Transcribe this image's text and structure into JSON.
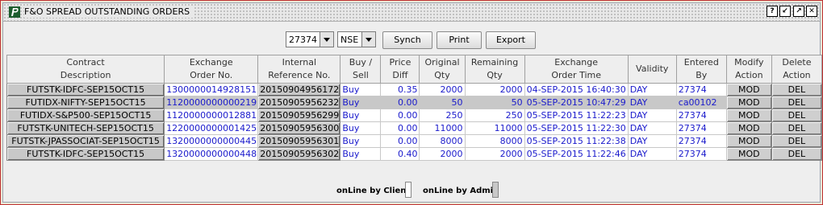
{
  "window": {
    "title": "F&O SPREAD OUTSTANDING ORDERS",
    "controls": [
      "?",
      "minimize",
      "maximize",
      "close"
    ]
  },
  "toolbar": {
    "account": "27374",
    "exchange": "NSE",
    "synch_label": "Synch",
    "print_label": "Print",
    "export_label": "Export"
  },
  "table": {
    "columns": [
      [
        "Contract",
        "Description"
      ],
      [
        "Exchange",
        "Order No."
      ],
      [
        "Internal",
        "Reference No."
      ],
      [
        "Buy /",
        "Sell"
      ],
      [
        "Price",
        "Diff"
      ],
      [
        "Original",
        "Qty"
      ],
      [
        "Remaining",
        "Qty"
      ],
      [
        "Exchange",
        "Order Time"
      ],
      [
        "Validity",
        ""
      ],
      [
        "Entered",
        "By"
      ],
      [
        "Modify",
        "Action"
      ],
      [
        "Delete",
        "Action"
      ]
    ],
    "rows": [
      {
        "contract": "FUTSTK-IDFC-SEP15OCT15",
        "exch_order": "1300000014928151",
        "ref": "20150904956172",
        "side": "Buy",
        "price_diff": "0.35",
        "orig_qty": "2000",
        "rem_qty": "2000",
        "time": "04-SEP-2015 16:40:30",
        "validity": "DAY",
        "entered_by": "27374",
        "modify": "MOD",
        "delete": "DEL",
        "selected": false
      },
      {
        "contract": "FUTIDX-NIFTY-SEP15OCT15",
        "exch_order": "1120000000000219",
        "ref": "20150905956232",
        "side": "Buy",
        "price_diff": "0.00",
        "orig_qty": "50",
        "rem_qty": "50",
        "time": "05-SEP-2015 10:47:29",
        "validity": "DAY",
        "entered_by": "ca00102",
        "modify": "MOD",
        "delete": "DEL",
        "selected": true
      },
      {
        "contract": "FUTIDX-S&P500-SEP15OCT15",
        "exch_order": "1120000000012881",
        "ref": "20150905956299",
        "side": "Buy",
        "price_diff": "0.00",
        "orig_qty": "250",
        "rem_qty": "250",
        "time": "05-SEP-2015 11:22:23",
        "validity": "DAY",
        "entered_by": "27374",
        "modify": "MOD",
        "delete": "DEL",
        "selected": false
      },
      {
        "contract": "FUTSTK-UNITECH-SEP15OCT15",
        "exch_order": "1220000000001425",
        "ref": "20150905956300",
        "side": "Buy",
        "price_diff": "0.00",
        "orig_qty": "11000",
        "rem_qty": "11000",
        "time": "05-SEP-2015 11:22:30",
        "validity": "DAY",
        "entered_by": "27374",
        "modify": "MOD",
        "delete": "DEL",
        "selected": false
      },
      {
        "contract": "FUTSTK-JPASSOCIAT-SEP15OCT15",
        "exch_order": "1320000000000445",
        "ref": "20150905956301",
        "side": "Buy",
        "price_diff": "0.00",
        "orig_qty": "8000",
        "rem_qty": "8000",
        "time": "05-SEP-2015 11:22:38",
        "validity": "DAY",
        "entered_by": "27374",
        "modify": "MOD",
        "delete": "DEL",
        "selected": false
      },
      {
        "contract": "FUTSTK-IDFC-SEP15OCT15",
        "exch_order": "1320000000000448",
        "ref": "20150905956302",
        "side": "Buy",
        "price_diff": "0.40",
        "orig_qty": "2000",
        "rem_qty": "2000",
        "time": "05-SEP-2015 11:22:46",
        "validity": "DAY",
        "entered_by": "27374",
        "modify": "MOD",
        "delete": "DEL",
        "selected": false
      }
    ]
  },
  "status": {
    "client_label": "onLine by Client",
    "admin_label": "onLine by Admin",
    "client_color": "#ffffff",
    "admin_color": "#c8c8c8"
  }
}
